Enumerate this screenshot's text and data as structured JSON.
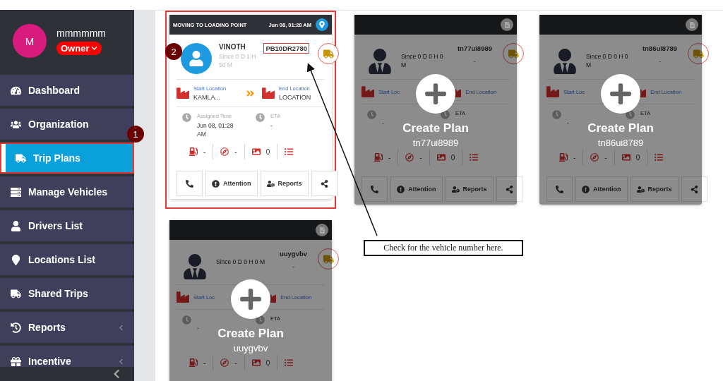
{
  "sidebar": {
    "user": {
      "initial": "M",
      "name": "mmmmmm",
      "role": "Owner"
    },
    "items": [
      {
        "label": "Dashboard",
        "selected": false,
        "has_submenu": false
      },
      {
        "label": "Organization",
        "selected": false,
        "has_submenu": false
      },
      {
        "label": "Trip Plans",
        "selected": true,
        "has_submenu": false,
        "highlighted": true,
        "marker": "1"
      },
      {
        "label": "Manage Vehicles",
        "selected": false,
        "has_submenu": false
      },
      {
        "label": "Drivers List",
        "selected": false,
        "has_submenu": false
      },
      {
        "label": "Locations List",
        "selected": false,
        "has_submenu": false
      },
      {
        "label": "Shared Trips",
        "selected": false,
        "has_submenu": false
      },
      {
        "label": "Reports",
        "selected": false,
        "has_submenu": true
      },
      {
        "label": "Incentive",
        "selected": false,
        "has_submenu": true
      }
    ]
  },
  "trip_cards": [
    {
      "kind": "active",
      "highlighted": true,
      "marker": "2",
      "status": "MOVING TO LOADING POINT",
      "date": "Jun 08, 01:28 AM",
      "driver": "VINOTH",
      "since": "Since 0 D 1 H 50 M",
      "vehicle": "PB10DR2780",
      "vehicle_highlighted": true,
      "start_label": "Start Location",
      "start_value": "KAMLA...",
      "end_label": "End Location",
      "end_value": "LOCATION",
      "assigned_label": "Assigned Time",
      "assigned_value": "Jun 08, 01:28 AM",
      "eta_label": "ETA",
      "eta_value": "-",
      "fuel": "-",
      "speed": "-",
      "images": "0",
      "buttons": [
        {
          "kind": "call"
        },
        {
          "kind": "attention",
          "label": "Attention"
        },
        {
          "kind": "reports",
          "label": "Reports"
        },
        {
          "kind": "share"
        }
      ]
    },
    {
      "kind": "empty",
      "highlighted": false,
      "since": "Since 0 D 0 H 0 M",
      "vehicle": "tn77ui8989",
      "vehicle_note": "-",
      "start_label": "Start Loc",
      "end_label": "End Location",
      "eta_label": "ETA",
      "assigned_value": "-",
      "fuel": "-",
      "speed": "-",
      "images": "0",
      "buttons": [
        {
          "kind": "call"
        },
        {
          "kind": "attention",
          "label": "Attention"
        },
        {
          "kind": "reports",
          "label": "Reports"
        },
        {
          "kind": "share"
        }
      ],
      "overlay": {
        "title": "Create Plan",
        "subtitle": "tn77ui8989"
      }
    },
    {
      "kind": "empty",
      "highlighted": false,
      "since": "Since 0 D 0 H 0 M",
      "vehicle": "tn86ui8789",
      "vehicle_note": "-",
      "start_label": "Start Loc",
      "end_label": "End Location",
      "eta_label": "ETA",
      "assigned_value": "-",
      "fuel": "-",
      "speed": "-",
      "images": "0",
      "buttons": [
        {
          "kind": "call"
        },
        {
          "kind": "attention",
          "label": "Attention"
        },
        {
          "kind": "reports",
          "label": "Reports"
        },
        {
          "kind": "share"
        }
      ],
      "overlay": {
        "title": "Create Plan",
        "subtitle": "tn86ui8789"
      }
    },
    {
      "kind": "empty",
      "highlighted": false,
      "since": "Since 0 D 0 H 0 M",
      "vehicle": "uuygvbv",
      "vehicle_note": "-",
      "start_label": "Start Loc",
      "end_label": "End Location",
      "eta_label": "ETA",
      "assigned_value": "-",
      "fuel": "-",
      "speed": "-",
      "images": "0",
      "overlay": {
        "title": "Create Plan",
        "subtitle": "uuygvbv"
      }
    }
  ],
  "callout": "Check for the vehicle number here."
}
